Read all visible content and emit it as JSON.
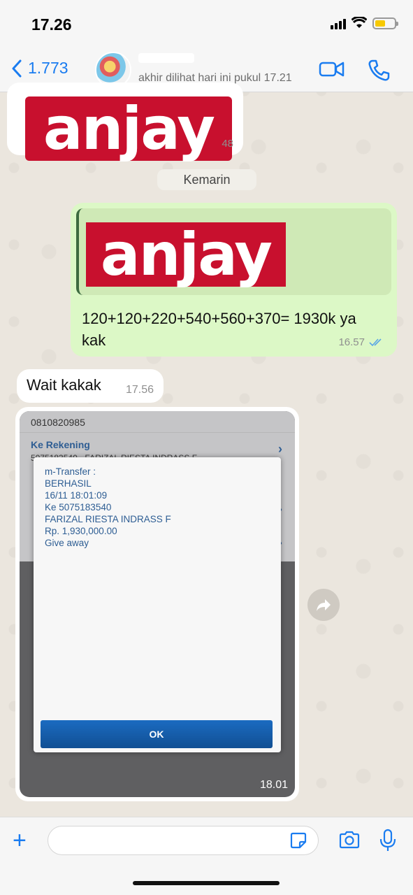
{
  "status_bar": {
    "time": "17.26"
  },
  "header": {
    "back_count": "1.773",
    "last_seen": "akhir dilihat hari ini pukul 17.21"
  },
  "chat": {
    "msg1": {
      "logo_text": "anjay",
      "time_partial": "48"
    },
    "date_chip": "Kemarin",
    "msg2": {
      "quote_logo": "anjay",
      "text": "120+120+220+540+560+370= 1930k ya kak",
      "time": "16.57"
    },
    "msg3": {
      "text": "Wait kakak",
      "time": "17.56"
    },
    "msg4": {
      "time": "18.01",
      "screenshot": {
        "account_number": "0810820985",
        "ke_rekening_label": "Ke Rekening",
        "ke_rekening_value": "5075183540 - FARIZAL RIESTA INDRASS F",
        "dialog_lines": [
          "m-Transfer :",
          "BERHASIL",
          "16/11 18:01:09",
          "Ke 5075183540",
          "FARIZAL RIESTA INDRASS F",
          "Rp. 1,930,000.00",
          "Give away"
        ],
        "ok_label": "OK"
      }
    }
  },
  "colors": {
    "accent": "#1a7cf0",
    "outgoing": "#dcf8c6",
    "incoming": "#ffffff",
    "logo_red": "#c8102e"
  }
}
